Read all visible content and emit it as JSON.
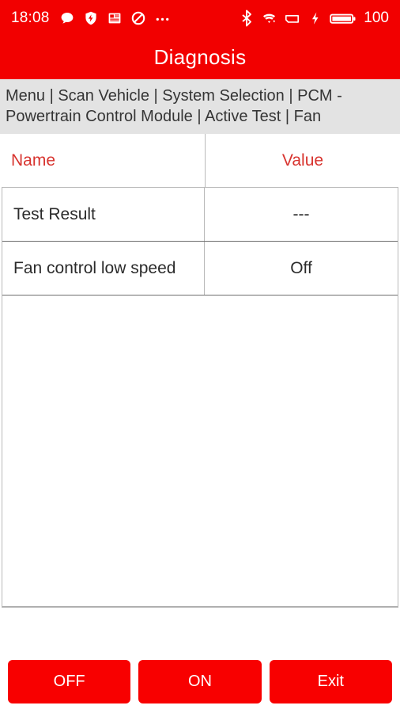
{
  "theme": {
    "status_bar_bg": "#f20000",
    "title_bar_bg": "#f20000",
    "breadcrumb_bg": "#e3e3e3",
    "accent_red": "#f80000",
    "header_text_red": "#d8342f",
    "body_text": "#2b2b2b"
  },
  "status_bar": {
    "time": "18:08",
    "battery_percent": "100",
    "left_icons": [
      {
        "name": "message-icon",
        "label": "message"
      },
      {
        "name": "shield-icon",
        "label": "security-shield"
      },
      {
        "name": "news-icon",
        "label": "news-document"
      },
      {
        "name": "do-not-disturb-icon",
        "label": "do-not-disturb"
      },
      {
        "name": "more-icon",
        "label": "more-notifications"
      }
    ],
    "right_icons": [
      {
        "name": "bluetooth-icon",
        "label": "bluetooth"
      },
      {
        "name": "wifi-icon",
        "label": "wifi"
      },
      {
        "name": "sim-icon",
        "label": "sim-card"
      },
      {
        "name": "charging-bolt-icon",
        "label": "charging"
      },
      {
        "name": "battery-icon",
        "label": "battery-full"
      }
    ]
  },
  "title_bar": {
    "title": "Diagnosis"
  },
  "breadcrumb": {
    "path": "Menu | Scan Vehicle | System Selection | PCM - Powertrain Control Module | Active Test | Fan"
  },
  "table": {
    "columns": [
      "Name",
      "Value"
    ],
    "rows": [
      {
        "name": "Test Result",
        "value": "---"
      },
      {
        "name": "Fan control low speed",
        "value": "Off"
      }
    ]
  },
  "buttons": [
    {
      "id": "off",
      "label": "OFF"
    },
    {
      "id": "on",
      "label": "ON"
    },
    {
      "id": "exit",
      "label": "Exit"
    }
  ]
}
